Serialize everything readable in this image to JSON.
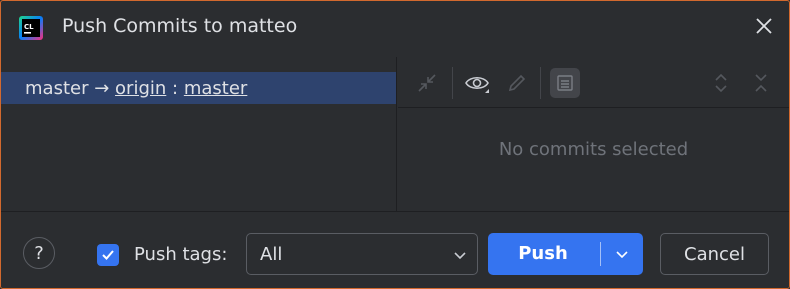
{
  "window": {
    "title": "Push Commits to matteo"
  },
  "icons": {
    "app": "clion-logo-icon",
    "close": "close-icon",
    "toolbar": [
      "merge-arrows-icon",
      "eye-icon",
      "pencil-icon",
      "details-panel-icon",
      "expand-icon",
      "collapse-icon"
    ]
  },
  "branches": {
    "row": {
      "local": "master",
      "arrow": "→",
      "remote": "origin",
      "sep": ":",
      "target": "master"
    }
  },
  "details": {
    "empty_text": "No commits selected"
  },
  "footer": {
    "help_label": "?",
    "push_tags_checked": true,
    "push_tags_label": "Push tags:",
    "tags_selected": "All",
    "push_label": "Push",
    "cancel_label": "Cancel"
  },
  "colors": {
    "background": "#2b2d30",
    "selection": "#2e436e",
    "accent": "#3574f0",
    "border_highlight": "#d2692e"
  }
}
